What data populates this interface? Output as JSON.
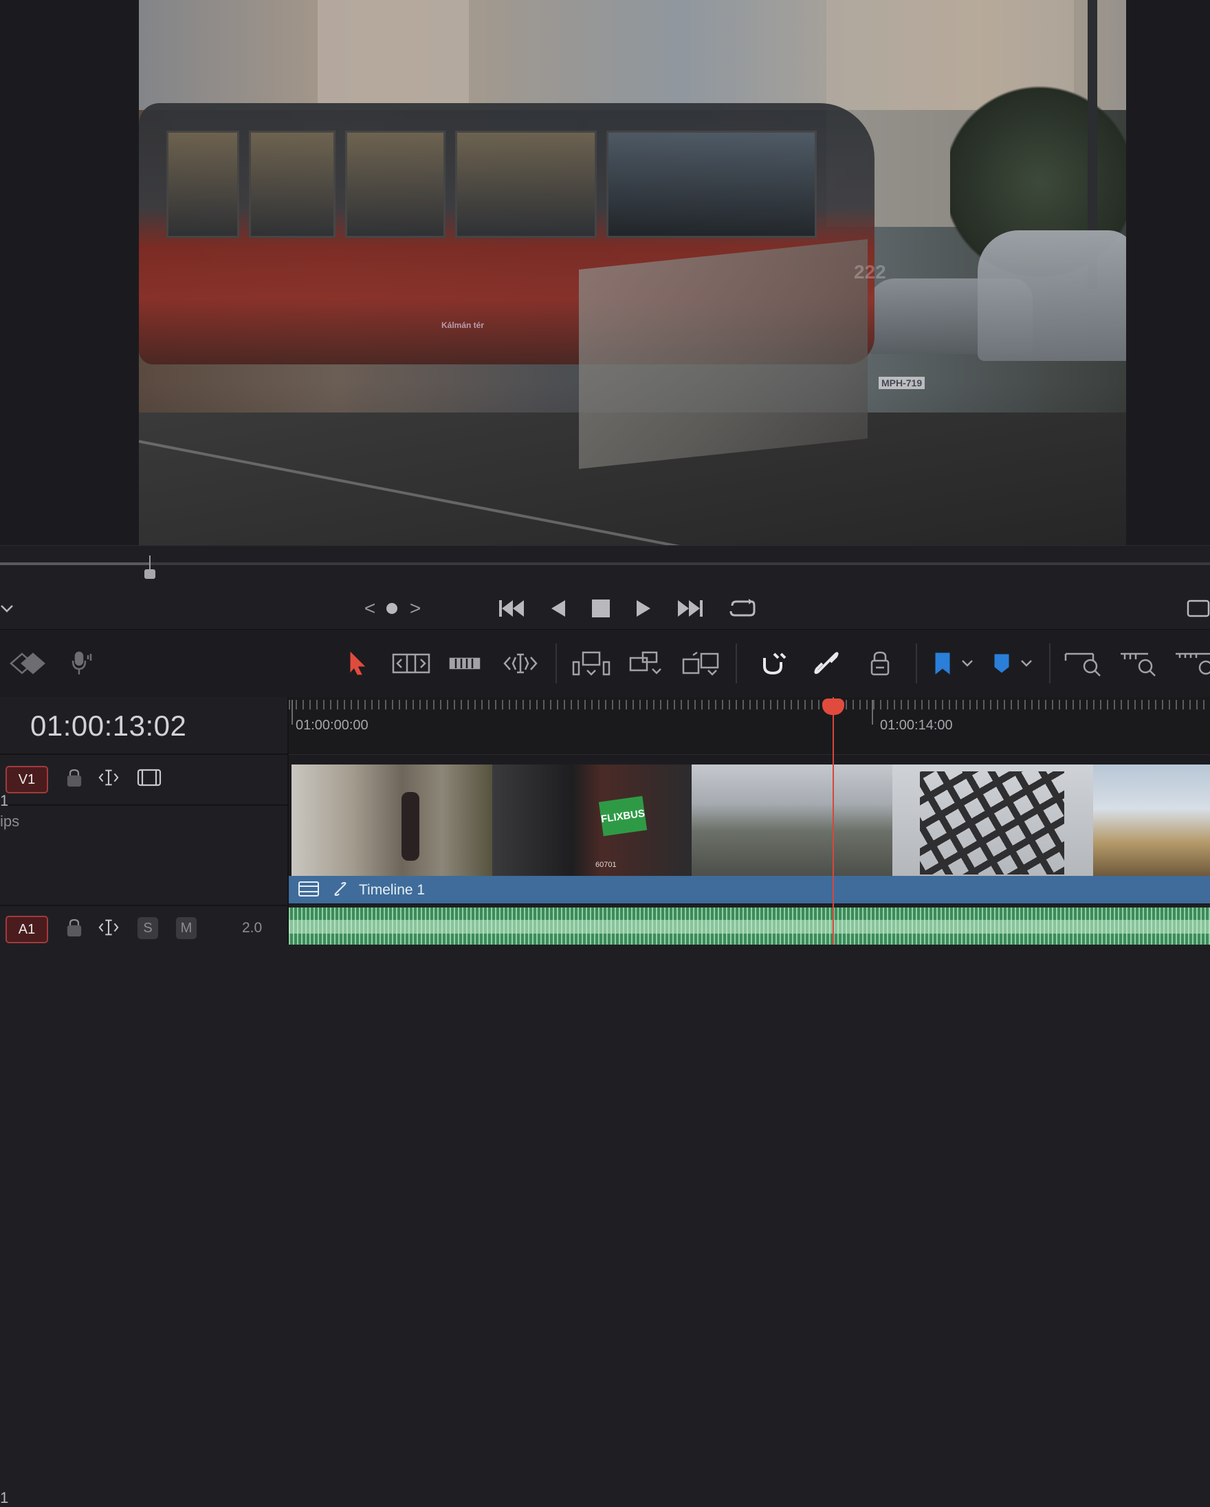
{
  "viewer": {
    "overlay_number": "222",
    "plate": "MPH-719",
    "sign_text": "Kálmán tér"
  },
  "transport": {
    "prev_clip": "<",
    "next_clip": ">"
  },
  "timeline": {
    "current_timecode": "01:00:13:02",
    "ruler_labels": [
      "01:00:00:00",
      "01:00:14:00"
    ],
    "v1": {
      "badge": "V1",
      "header_line1": "1",
      "header_line2": "ips",
      "clip_bar_label": "Timeline 1",
      "clips": [
        {
          "name": "stairs-woman",
          "sticker": ""
        },
        {
          "name": "bus-interior",
          "sticker": "FLIXBUS",
          "code": "60701"
        },
        {
          "name": "city-view",
          "sticker": ""
        },
        {
          "name": "building-lattice",
          "sticker": ""
        },
        {
          "name": "heroes-square",
          "sticker": ""
        }
      ]
    },
    "a1": {
      "badge": "A1",
      "solo": "S",
      "mute": "M",
      "level": "2.0"
    }
  },
  "colors": {
    "accent_red": "#e14b3d",
    "clip_blue": "#3f6c9a",
    "audio_green": "#3e8a5a",
    "marker_blue": "#2a7fd8"
  }
}
